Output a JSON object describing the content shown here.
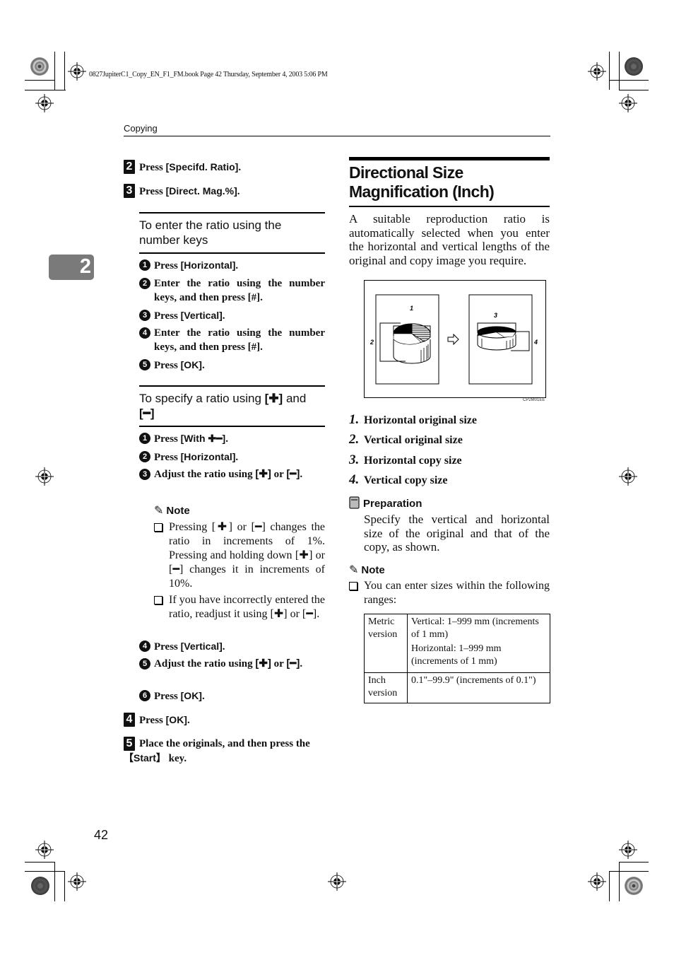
{
  "print_info": "0827JupiterC1_Copy_EN_F1_FM.book  Page 42  Thursday, September 4, 2003  5:06 PM",
  "running_head": "Copying",
  "chapter_tab": "2",
  "page_number": "42",
  "left": {
    "steps": [
      {
        "num": "2",
        "prefix": "Press ",
        "key": "[Specifd. Ratio]",
        "suffix": "."
      },
      {
        "num": "3",
        "prefix": "Press ",
        "key": "[Direct. Mag.%]",
        "suffix": "."
      }
    ],
    "section1": {
      "heading": "To enter the ratio using the number keys",
      "items": [
        {
          "num": "1",
          "prefix": "Press ",
          "key": "[Horizontal]",
          "suffix": "."
        },
        {
          "num": "2",
          "text": "Enter the ratio using the number keys, and then press [#]."
        },
        {
          "num": "3",
          "prefix": "Press ",
          "key": "[Vertical]",
          "suffix": "."
        },
        {
          "num": "4",
          "text": "Enter the ratio using the number keys, and then press [#]."
        },
        {
          "num": "5",
          "prefix": "Press ",
          "key": "[OK]",
          "suffix": "."
        }
      ]
    },
    "section2": {
      "heading_prefix": "To specify a ratio using ",
      "heading_plus": "[✚]",
      "heading_and": " and ",
      "heading_minus": "[━]",
      "items": [
        {
          "num": "1",
          "prefix": "Press ",
          "key": "[With ✚━]",
          "suffix": "."
        },
        {
          "num": "2",
          "prefix": "Press ",
          "key": "[Horizontal]",
          "suffix": "."
        },
        {
          "num": "3",
          "text_a": "Adjust the ratio using ",
          "plus": "[✚]",
          "text_b": " or ",
          "minus": "[━]",
          "text_c": "."
        },
        {
          "num": "4",
          "prefix": "Press ",
          "key": "[Vertical]",
          "suffix": "."
        },
        {
          "num": "5",
          "text_a": "Adjust the ratio using ",
          "plus": "[✚]",
          "text_b": " or ",
          "minus": "[━]",
          "text_c": "."
        },
        {
          "num": "6",
          "prefix": "Press ",
          "key": "[OK]",
          "suffix": "."
        }
      ],
      "note": {
        "title": "Note",
        "bullets": [
          "Pressing [✚] or [━] changes the ratio in increments of 1%. Pressing and holding down [✚] or [━] changes it in increments of 10%.",
          "If you have incorrectly entered the ratio, readjust it using [✚] or [━]."
        ]
      }
    },
    "final_steps": [
      {
        "num": "4",
        "prefix": "Press ",
        "key": "[OK]",
        "suffix": "."
      },
      {
        "num": "5",
        "prefix": "Place the originals, and then press the ",
        "key": "【Start】",
        "suffix": " key."
      }
    ]
  },
  "right": {
    "title": "Directional Size Magnification (Inch)",
    "intro": "A suitable reproduction ratio is automatically selected when you enter the horizontal and vertical lengths of the original and copy image you require.",
    "figure": {
      "code": "CP2M01EE",
      "labels": [
        "1",
        "2",
        "3",
        "4"
      ],
      "arrow_icon": "hollow-right-arrow"
    },
    "legend": [
      {
        "num": "1.",
        "text": "Horizontal original size"
      },
      {
        "num": "2.",
        "text": "Vertical original size"
      },
      {
        "num": "3.",
        "text": "Horizontal copy size"
      },
      {
        "num": "4.",
        "text": "Vertical copy size"
      }
    ],
    "preparation": {
      "title": "Preparation",
      "text": "Specify the vertical and horizontal size of the original and that of the copy, as shown."
    },
    "note": {
      "title": "Note",
      "bullet": "You can enter sizes within the following ranges:"
    },
    "ranges_table": [
      {
        "version": "Metric version",
        "values": [
          "Vertical: 1–999 mm (increments of 1 mm)",
          "Horizontal: 1–999 mm (increments of 1 mm)"
        ]
      },
      {
        "version": "Inch version",
        "values": [
          "0.1\"–99.9\" (increments of 0.1\")"
        ]
      }
    ]
  }
}
